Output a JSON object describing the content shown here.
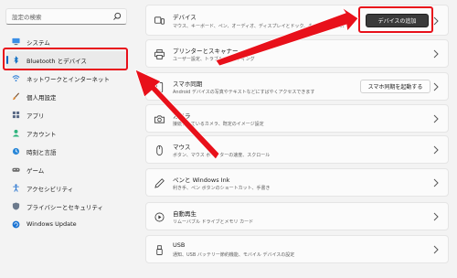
{
  "search": {
    "placeholder": "設定の検索"
  },
  "sidebar": {
    "items": [
      {
        "label": "システム",
        "icon": "monitor-icon"
      },
      {
        "label": "Bluetooth とデバイス",
        "icon": "bluetooth-icon",
        "active": true
      },
      {
        "label": "ネットワークとインターネット",
        "icon": "wifi-icon"
      },
      {
        "label": "個人用設定",
        "icon": "brush-icon"
      },
      {
        "label": "アプリ",
        "icon": "apps-icon"
      },
      {
        "label": "アカウント",
        "icon": "person-icon"
      },
      {
        "label": "時刻と言語",
        "icon": "globe-clock-icon"
      },
      {
        "label": "ゲーム",
        "icon": "gamepad-icon"
      },
      {
        "label": "アクセシビリティ",
        "icon": "accessibility-icon"
      },
      {
        "label": "プライバシーとセキュリティ",
        "icon": "shield-icon"
      },
      {
        "label": "Windows Update",
        "icon": "update-icon"
      }
    ]
  },
  "cards": [
    {
      "title": "デバイス",
      "subtitle": "マウス、キーボード、ペン、オーディオ、ディスプレイとドック、その他のデバイス",
      "icon": "devices-icon",
      "button": "デバイスの追加"
    },
    {
      "title": "プリンターとスキャナー",
      "subtitle": "ユーザー設定、トラブルシューティング",
      "icon": "printer-icon"
    },
    {
      "title": "スマホ同期",
      "subtitle": "Android デバイスの写真やテキストなどにすばやくアクセスできます",
      "icon": "phone-icon",
      "button": "スマホ同期を起動する"
    },
    {
      "title": "カメラ",
      "subtitle": "接続されているカメラ、既定のイメージ設定",
      "icon": "camera-icon"
    },
    {
      "title": "マウス",
      "subtitle": "ボタン、マウス ポインターの速度、スクロール",
      "icon": "mouse-icon"
    },
    {
      "title": "ペンと Windows Ink",
      "subtitle": "利き手、ペン ボタンのショートカット、手書き",
      "icon": "pen-icon"
    },
    {
      "title": "自動再生",
      "subtitle": "リムーバブル ドライブとメモリ カード",
      "icon": "autoplay-icon"
    },
    {
      "title": "USB",
      "subtitle": "通知、USB バッテリー節約機能、モバイル デバイスの設定",
      "icon": "usb-icon"
    }
  ],
  "colors": {
    "accent": "#0067c0",
    "annotation": "#e8101a",
    "button_dark": "#3a3a3a"
  }
}
